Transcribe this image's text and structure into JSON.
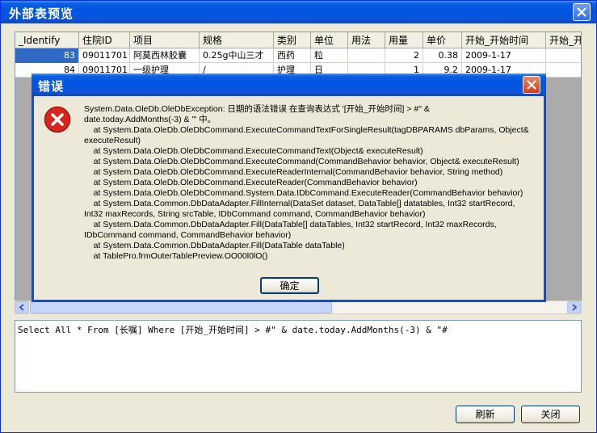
{
  "window": {
    "title": "外部表预览"
  },
  "grid": {
    "columns": [
      "_Identify",
      "住院ID",
      "项目",
      "规格",
      "类别",
      "单位",
      "用法",
      "用量",
      "单价",
      "开始_开始时间",
      "开始_开"
    ],
    "rows": [
      [
        "83",
        "09011701",
        "阿莫西林胶囊",
        "0.25g中山三才",
        "西药",
        "粒",
        "",
        "2",
        "0.38",
        "2009-1-17"
      ],
      [
        "84",
        "09011701",
        "一级护理",
        "/",
        "护理",
        "日",
        "",
        "1",
        "9.2",
        "2009-1-17"
      ]
    ]
  },
  "sql": {
    "text": "Select All * From [长嘱] Where [开始_开始时间] > #\" & date.today.AddMonths(-3) & \"#"
  },
  "buttons": {
    "refresh": "刷新",
    "close": "关闭"
  },
  "dialog": {
    "title": "错误",
    "icon": "error-icon",
    "message": "System.Data.OleDb.OleDbException: 日期的语法错误 在查询表达式 '[开始_开始时间] > #\" &\ndate.today.AddMonths(-3) & \"' 中。\n    at System.Data.OleDb.OleDbCommand.ExecuteCommandTextForSingleResult(tagDBPARAMS dbParams, Object&\nexecuteResult)\n    at System.Data.OleDb.OleDbCommand.ExecuteCommandText(Object& executeResult)\n    at System.Data.OleDb.OleDbCommand.ExecuteCommand(CommandBehavior behavior, Object& executeResult)\n    at System.Data.OleDb.OleDbCommand.ExecuteReaderInternal(CommandBehavior behavior, String method)\n    at System.Data.OleDb.OleDbCommand.ExecuteReader(CommandBehavior behavior)\n    at System.Data.OleDb.OleDbCommand.System.Data.IDbCommand.ExecuteReader(CommandBehavior behavior)\n    at System.Data.Common.DbDataAdapter.FillInternal(DataSet dataset, DataTable[] datatables, Int32 startRecord,\nInt32 maxRecords, String srcTable, IDbCommand command, CommandBehavior behavior)\n    at System.Data.Common.DbDataAdapter.Fill(DataTable[] dataTables, Int32 startRecord, Int32 maxRecords,\nIDbCommand command, CommandBehavior behavior)\n    at System.Data.Common.DbDataAdapter.Fill(DataTable dataTable)\n    at TablePro.frmOuterTablePreview.OO00l0lO()",
    "ok": "确定"
  },
  "colors": {
    "titlebar": "#0054e3",
    "selection": "#316ac5",
    "error": "#d9261c"
  }
}
